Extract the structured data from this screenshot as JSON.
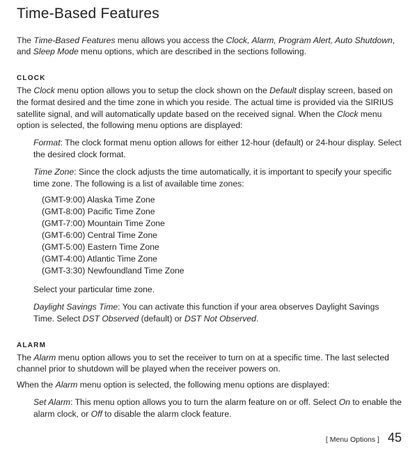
{
  "title": "Time-Based Features",
  "intro_parts": {
    "p1a": "The ",
    "p1b": "Time-Based Features",
    "p1c": " menu allows you access the ",
    "p1d": "Clock, Alarm, Program Alert, Auto Shutdown",
    "p1e": ", and ",
    "p1f": "Sleep Mode",
    "p1g": " menu options, which are described in the sections following."
  },
  "clock": {
    "header": "CLOCK",
    "p1a": "The ",
    "p1b": "Clock",
    "p1c": " menu option allows you to setup the clock shown on the ",
    "p1d": "Default",
    "p1e": " display screen, based on the format desired and the time zone in which you reside. The actual time is provided via the SIRIUS satellite signal, and will automatically update based on the received signal. When the ",
    "p1f": "Clock",
    "p1g": " menu option is selected, the following menu options are displayed:",
    "format_a": "Format",
    "format_b": ": The clock format menu option allows for either 12-hour (default) or 24-hour display. Select the desired clock format.",
    "tz_a": "Time Zone",
    "tz_b": ": Since the clock adjusts the time automatically, it is important to specify your specific time zone. The following is a list of available time zones:",
    "timezones": [
      "(GMT-9:00) Alaska Time Zone",
      "(GMT-8:00) Pacific Time Zone",
      "(GMT-7:00) Mountain Time Zone",
      "(GMT-6:00) Central Time Zone",
      "(GMT-5:00) Eastern Time Zone",
      "(GMT-4:00) Atlantic Time Zone",
      "(GMT-3:30) Newfoundland Time Zone"
    ],
    "select_tz": "Select your particular time zone.",
    "dst_a": "Daylight Savings Time",
    "dst_b": ": You can activate this function if your area observes Daylight Savings Time. Select ",
    "dst_c": "DST Observed",
    "dst_d": " (default) or ",
    "dst_e": "DST Not Observed",
    "dst_f": "."
  },
  "alarm": {
    "header": "ALARM",
    "p1a": "The ",
    "p1b": "Alarm",
    "p1c": " menu option allows you to set the receiver to turn on at a specific time. The last selected channel prior to shutdown will be played when the receiver powers on.",
    "p2a": "When the ",
    "p2b": "Alarm",
    "p2c": " menu option is selected, the following menu options are displayed:",
    "set_a": "Set Alarm",
    "set_b": ": This menu option allows you to turn the alarm feature on or off. Select ",
    "set_c": "On",
    "set_d": " to enable the alarm clock, or ",
    "set_e": "Off",
    "set_f": " to disable the alarm clock feature."
  },
  "footer": {
    "label": "[ Menu Options ]",
    "page": "45"
  }
}
